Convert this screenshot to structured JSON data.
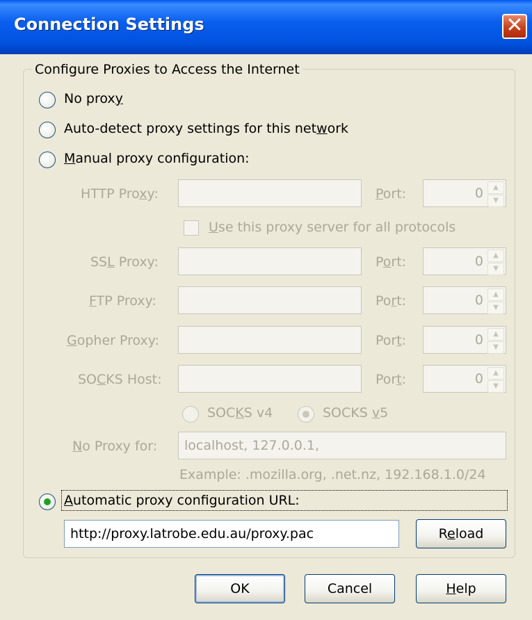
{
  "dialog": {
    "title": "Connection Settings"
  },
  "group": {
    "label": "Configure Proxies to Access the Internet"
  },
  "options": {
    "no_proxy": {
      "pre": "No prox",
      "key": "y",
      "post": ""
    },
    "auto_detect": {
      "pre": "Auto-detect proxy settings for this net",
      "key": "w",
      "post": "ork"
    },
    "manual": {
      "pre": "",
      "key": "M",
      "post": "anual proxy configuration:"
    },
    "auto_url": {
      "pre": "",
      "key": "A",
      "post": "utomatic proxy configuration URL:"
    }
  },
  "manual": {
    "http": {
      "pre": "HTTP Pro",
      "key": "x",
      "post": "y:",
      "value": "",
      "port_pre": "",
      "port_key": "P",
      "port_post": "ort:",
      "port": "0"
    },
    "use_all": {
      "pre": "",
      "key": "U",
      "post": "se this proxy server for all protocols"
    },
    "ssl": {
      "pre": "SS",
      "key": "L",
      "post": " Proxy:",
      "value": "",
      "port_pre": "P",
      "port_key": "o",
      "port_post": "rt:",
      "port": "0"
    },
    "ftp": {
      "pre": "",
      "key": "F",
      "post": "TP Proxy:",
      "value": "",
      "port_pre": "Po",
      "port_key": "r",
      "port_post": "t:",
      "port": "0"
    },
    "gopher": {
      "pre": "",
      "key": "G",
      "post": "opher Proxy:",
      "value": "",
      "port_pre": "Por",
      "port_key": "t",
      "port_post": ":",
      "port": "0"
    },
    "socks": {
      "pre": "SO",
      "key": "C",
      "post": "KS Host:",
      "value": "",
      "port_pre": "Por",
      "port_key": "t",
      "port_post": ":",
      "port": "0"
    },
    "socks_v4": {
      "pre": "SOC",
      "key": "K",
      "post": "S v4"
    },
    "socks_v5": {
      "pre": "SOCKS ",
      "key": "v",
      "post": "5"
    },
    "no_proxy_for": {
      "pre": "",
      "key": "N",
      "post": "o Proxy for:",
      "value": "localhost, 127.0.0.1,"
    },
    "example": "Example: .mozilla.org, .net.nz, 192.168.1.0/24"
  },
  "auto": {
    "url": "http://proxy.latrobe.edu.au/proxy.pac",
    "reload_pre": "R",
    "reload_key": "e",
    "reload_post": "load"
  },
  "buttons": {
    "ok": "OK",
    "cancel": "Cancel",
    "help_pre": "",
    "help_key": "H",
    "help_post": "elp"
  },
  "colors": {
    "title_bar": "#0A5FEF",
    "close": "#C7411D",
    "dialog_bg": "#ECE9D8",
    "disabled_text": "#ACA899",
    "radio_check": "#21A121"
  }
}
